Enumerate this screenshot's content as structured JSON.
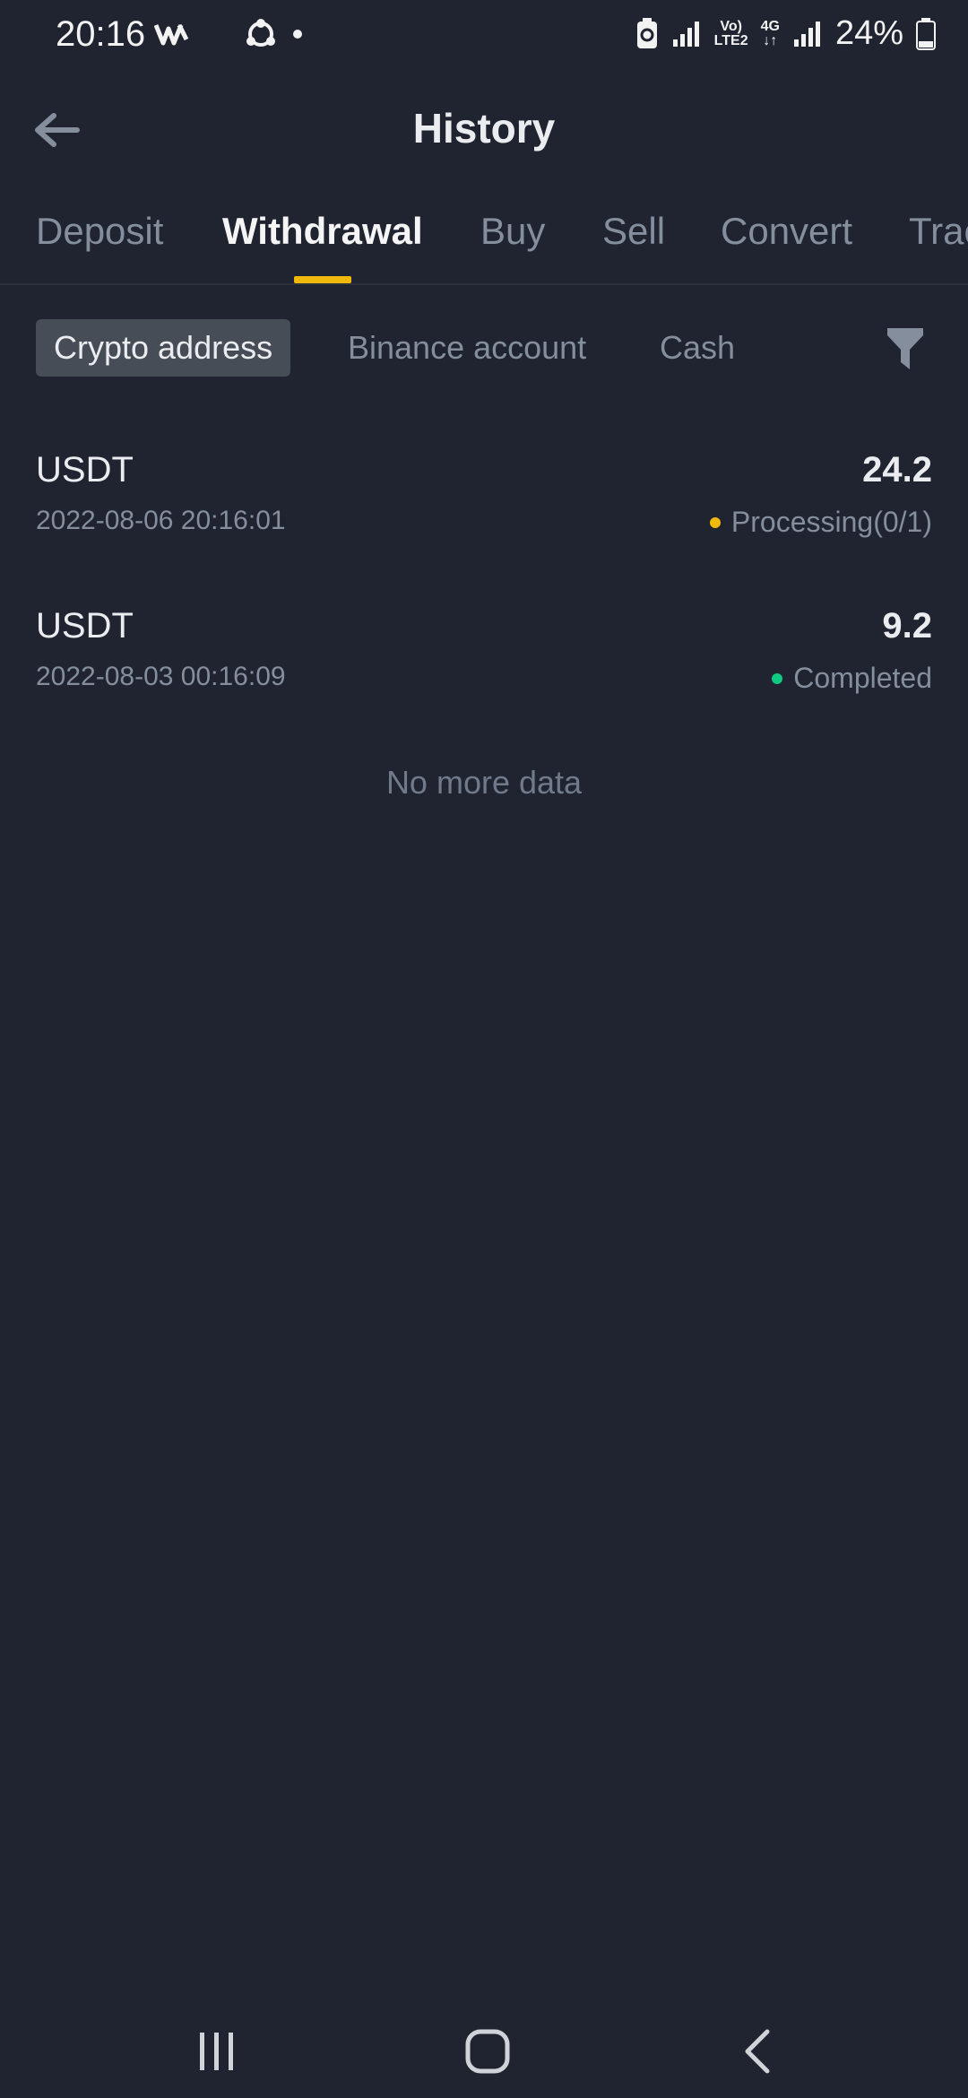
{
  "status_bar": {
    "time": "20:16",
    "battery": "24%",
    "network_label_top": "Vo)",
    "network_label_bottom": "LTE2",
    "network_4g": "4G"
  },
  "header": {
    "title": "History"
  },
  "tabs": [
    {
      "label": "Deposit",
      "active": false
    },
    {
      "label": "Withdrawal",
      "active": true
    },
    {
      "label": "Buy",
      "active": false
    },
    {
      "label": "Sell",
      "active": false
    },
    {
      "label": "Convert",
      "active": false
    },
    {
      "label": "Trac",
      "active": false
    }
  ],
  "subfilters": [
    {
      "label": "Crypto address",
      "active": true
    },
    {
      "label": "Binance account",
      "active": false
    },
    {
      "label": "Cash",
      "active": false
    }
  ],
  "transactions": [
    {
      "coin": "USDT",
      "date": "2022-08-06 20:16:01",
      "amount": "24.2",
      "status": "Processing(0/1)",
      "status_color": "#f0b90b"
    },
    {
      "coin": "USDT",
      "date": "2022-08-03 00:16:09",
      "amount": "9.2",
      "status": "Completed",
      "status_color": "#0ecb81"
    }
  ],
  "empty_text": "No more data",
  "colors": {
    "background": "#1f2430",
    "accent": "#f0b90b",
    "success": "#0ecb81"
  }
}
